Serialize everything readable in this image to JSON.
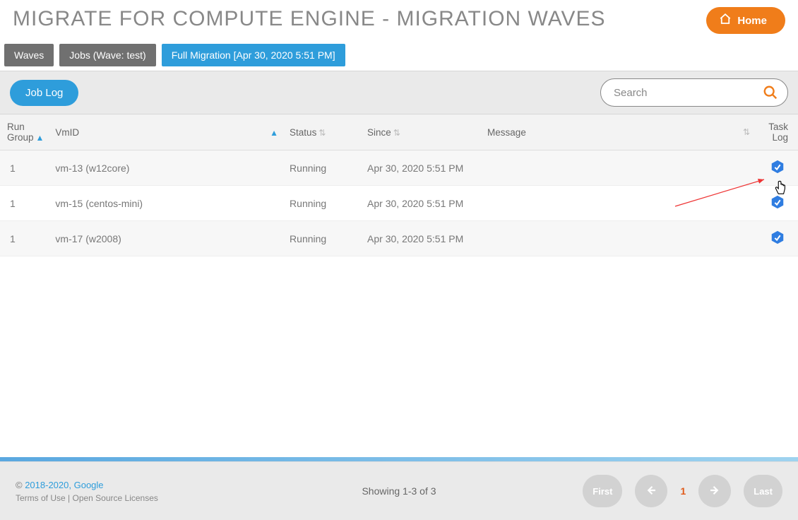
{
  "header": {
    "title": "Migrate for Compute Engine - Migration Waves",
    "home_label": "Home"
  },
  "tabs": {
    "waves": "Waves",
    "jobs": "Jobs (Wave: test)",
    "full": "Full Migration [Apr 30, 2020 5:51 PM]"
  },
  "toolbar": {
    "joblog_label": "Job Log"
  },
  "search": {
    "placeholder": "Search",
    "value": ""
  },
  "columns": {
    "run_group": "Run Group",
    "vmid": "VmID",
    "status": "Status",
    "since": "Since",
    "message": "Message",
    "task_log": "Task Log"
  },
  "rows": [
    {
      "run_group": "1",
      "vmid": "vm-13 (w12core)",
      "status": "Running",
      "since": "Apr 30, 2020 5:51 PM",
      "message": ""
    },
    {
      "run_group": "1",
      "vmid": "vm-15 (centos-mini)",
      "status": "Running",
      "since": "Apr 30, 2020 5:51 PM",
      "message": ""
    },
    {
      "run_group": "1",
      "vmid": "vm-17 (w2008)",
      "status": "Running",
      "since": "Apr 30, 2020 5:51 PM",
      "message": ""
    }
  ],
  "footer": {
    "copyright_prefix": "© ",
    "copyright_link": "2018-2020, Google",
    "terms": "Terms of Use",
    "separator": " | ",
    "licenses": "Open Source Licenses",
    "showing": "Showing 1-3 of 3",
    "first": "First",
    "last": "Last",
    "current_page": "1"
  },
  "colors": {
    "accent": "#2e9ddb",
    "orange": "#f07d1a"
  }
}
